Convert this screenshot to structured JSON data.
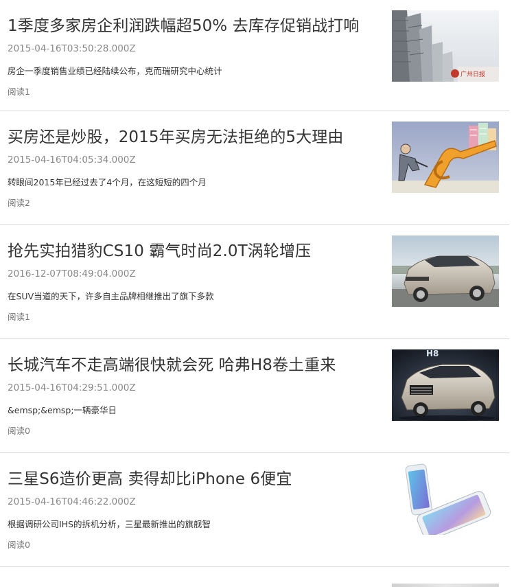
{
  "articles": [
    {
      "title": "1季度多家房企利润跌幅超50% 去库存促销战打响",
      "date": "2015-04-16T03:50:28.000Z",
      "summary": "房企一季度销售业绩已经陆续公布，克而瑞研究中心统计",
      "reads": "阅读1",
      "thumb_icon": "skyscrapers-photo"
    },
    {
      "title": "买房还是炒股，2015年买房无法拒绝的5大理由",
      "date": "2015-04-16T04:05:34.000Z",
      "summary": "转眼间2015年已经过去了4个月，在这短短的四个月",
      "reads": "阅读2",
      "thumb_icon": "cartoon-pushing-dollar-illustration"
    },
    {
      "title": "抢先实拍猎豹CS10 霸气时尚2.0T涡轮增压",
      "date": "2016-12-07T08:49:04.000Z",
      "summary": "在SUV当道的天下，许多自主品牌相继推出了旗下多款",
      "reads": "阅读1",
      "thumb_icon": "silver-suv-photo"
    },
    {
      "title": "长城汽车不走高端很快就会死 哈弗H8卷土重来",
      "date": "2015-04-16T04:29:51.000Z",
      "summary": "&emsp;&emsp;一辆豪华日",
      "reads": "阅读0",
      "thumb_icon": "suv-auto-show-photo"
    },
    {
      "title": "三星S6造价更高 卖得却比iPhone 6便宜",
      "date": "2015-04-16T04:46:22.000Z",
      "summary": "根据调研公司IHS的拆机分析，三星最新推出的旗舰智",
      "reads": "阅读0",
      "thumb_icon": "smartphones-photo"
    }
  ]
}
